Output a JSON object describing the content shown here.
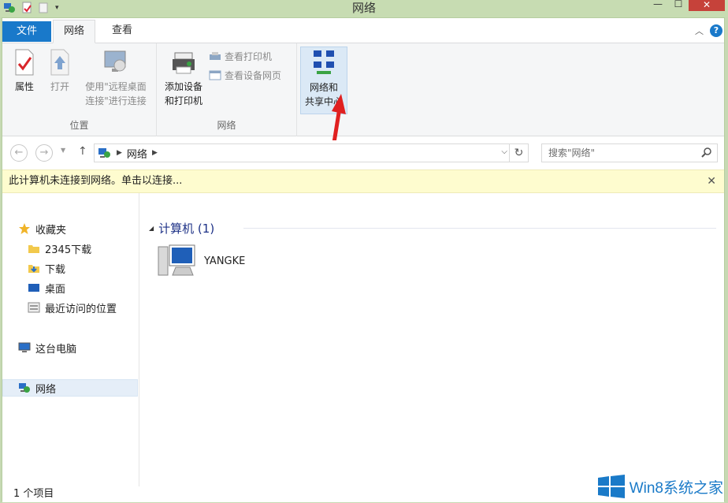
{
  "window": {
    "title": "网络"
  },
  "ribbon_tabs": {
    "file": "文件",
    "network": "网络",
    "view": "查看"
  },
  "ribbon": {
    "location_group": {
      "label": "位置",
      "properties": "属性",
      "open": "打开",
      "remote_line1": "使用\"远程桌面",
      "remote_line2": "连接\"进行连接"
    },
    "network_group": {
      "label": "网络",
      "add_line1": "添加设备",
      "add_line2": "和打印机",
      "view_printers": "查看打印机",
      "view_device_page": "查看设备网页"
    },
    "nsc_group": {
      "line1": "网络和",
      "line2": "共享中心"
    }
  },
  "address": {
    "location": "网络",
    "search_placeholder": "搜索\"网络\""
  },
  "infobar": {
    "message": "此计算机未连接到网络。单击以连接..."
  },
  "navpane": {
    "favorites": "收藏夹",
    "fav_items": [
      "2345下载",
      "下载",
      "桌面",
      "最近访问的位置"
    ],
    "this_pc": "这台电脑",
    "network": "网络"
  },
  "content": {
    "group_header": "计算机 (1)",
    "computer_name": "YANGKE"
  },
  "status": {
    "count": "1 个项目"
  },
  "watermark": {
    "text": "Win8系统之家"
  },
  "colors": {
    "accent": "#1979ca",
    "title_bar": "#c7dcb2",
    "info_bar": "#fefccf",
    "arrow": "#e02020"
  }
}
